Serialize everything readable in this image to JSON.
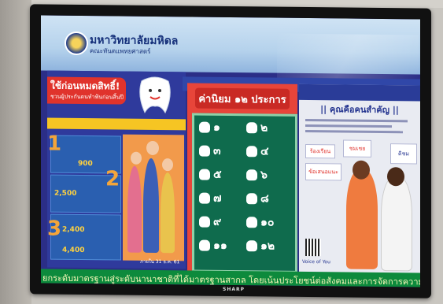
{
  "poster": {
    "university": "มหาวิทยาลัยมหิดล",
    "faculty": "คณะทันตแพทยศาสตร์",
    "left_title": "ใช้ก่อนหมดสิทธิ์!",
    "left_subtitle": "ชวนผู้ประกันตนทำฟันก่อนสิ้นปี",
    "amounts": [
      "900",
      "2,500",
      "2,400",
      "4,400"
    ],
    "step_numbers": [
      "1",
      "2",
      "3"
    ],
    "left_date": "ภายใน 31 ธ.ค. 61",
    "center_title": "ค่านิยม ๑๒ ประการ",
    "values_numbers": [
      "๑",
      "๒",
      "๓",
      "๔",
      "๕",
      "๖",
      "๗",
      "๘",
      "๙",
      "๑๐",
      "๑๑",
      "๑๒"
    ],
    "right_title": "|| คุณคือคนสำคัญ ||",
    "right_cards": [
      "ร้องเรียน",
      "ชมเชย",
      "ข้อเสนอแนะ",
      "ติชม"
    ],
    "right_voice": "Voice of You",
    "ticker": "ยกระดับมาตรฐานสู่ระดับนานาชาติที่ได้มาตรฐานสากล โดยเน้นประโยชน์ต่อสังคมและการจัดการความรู้"
  },
  "tv_brand": "SHARP",
  "colors": {
    "screen_bg": "#2b2e87",
    "accent_red": "#e0332c",
    "board_green": "#0f6b4d",
    "ticker_green": "#0d8a3c"
  }
}
